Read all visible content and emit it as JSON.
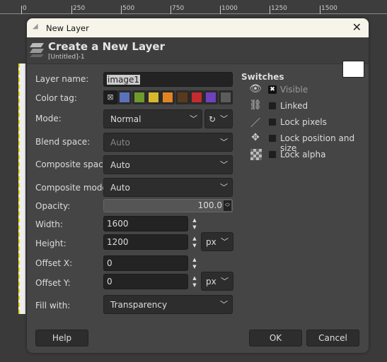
{
  "ruler": {
    "ticks": [
      "0",
      "250",
      "500",
      "750",
      "1000",
      "1250",
      "1500"
    ]
  },
  "dialog": {
    "window_title": "New Layer",
    "header_title": "Create a New Layer",
    "header_subtitle": "[Untitled]-1",
    "close_icon": "close-icon",
    "form": {
      "layer_name_label": "Layer name:",
      "layer_name_value": "image1",
      "color_tag_label": "Color tag:",
      "color_tags": [
        "#5a73b8",
        "#6f9a2c",
        "#d8b82c",
        "#e38424",
        "#5a3a1e",
        "#c42a2f",
        "#7041bf",
        "#5c5c5c"
      ],
      "mode_label": "Mode:",
      "mode_value": "Normal",
      "blend_space_label": "Blend space:",
      "blend_space_value": "Auto",
      "composite_space_label": "Composite space:",
      "composite_space_value": "Auto",
      "composite_mode_label": "Composite mode:",
      "composite_mode_value": "Auto",
      "opacity_label": "Opacity:",
      "opacity_value": "100.0",
      "width_label": "Width:",
      "width_value": "1600",
      "height_label": "Height:",
      "height_value": "1200",
      "size_unit": "px",
      "offset_x_label": "Offset X:",
      "offset_x_value": "0",
      "offset_y_label": "Offset Y:",
      "offset_y_value": "0",
      "offset_unit": "px",
      "fill_label": "Fill with:",
      "fill_value": "Transparency"
    },
    "switches": {
      "title": "Switches",
      "items": [
        {
          "label": "Visible",
          "checked": true,
          "icon": "eye-icon"
        },
        {
          "label": "Linked",
          "checked": false,
          "icon": "chain-icon"
        },
        {
          "label": "Lock pixels",
          "checked": false,
          "icon": "brush-icon"
        },
        {
          "label": "Lock position and size",
          "checked": false,
          "icon": "move-icon"
        },
        {
          "label": "Lock alpha",
          "checked": false,
          "icon": "checkerboard-icon"
        }
      ]
    },
    "buttons": {
      "help": "Help",
      "ok": "OK",
      "cancel": "Cancel"
    }
  }
}
